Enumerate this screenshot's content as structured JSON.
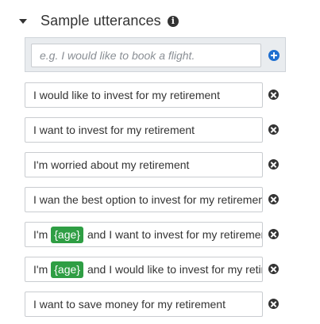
{
  "section": {
    "title": "Sample utterances",
    "collapse_icon": "caret-down-icon",
    "info_icon": "info-icon"
  },
  "new_utterance": {
    "placeholder": "e.g. I would like to book a flight.",
    "add_icon": "plus-circle-icon",
    "add_color": "#1f6fd0"
  },
  "utterances": [
    {
      "before": "I would like to invest for my retirement",
      "slot": "",
      "after": ""
    },
    {
      "before": "I want to invest for my retirement",
      "slot": "",
      "after": ""
    },
    {
      "before": "I'm worried about my retirement",
      "slot": "",
      "after": ""
    },
    {
      "before": "I wan the best option to invest for my retirement",
      "slot": "",
      "after": ""
    },
    {
      "before": "I'm",
      "slot": "{age}",
      "after": "and I want to invest for my retirement"
    },
    {
      "before": "I'm",
      "slot": "{age}",
      "after": "and I would like to invest for my retirement"
    },
    {
      "before": "I want to save money for my retirement",
      "slot": "",
      "after": ""
    }
  ],
  "remove_icon": "remove-circle-icon",
  "slot_color": "#2f9e44"
}
